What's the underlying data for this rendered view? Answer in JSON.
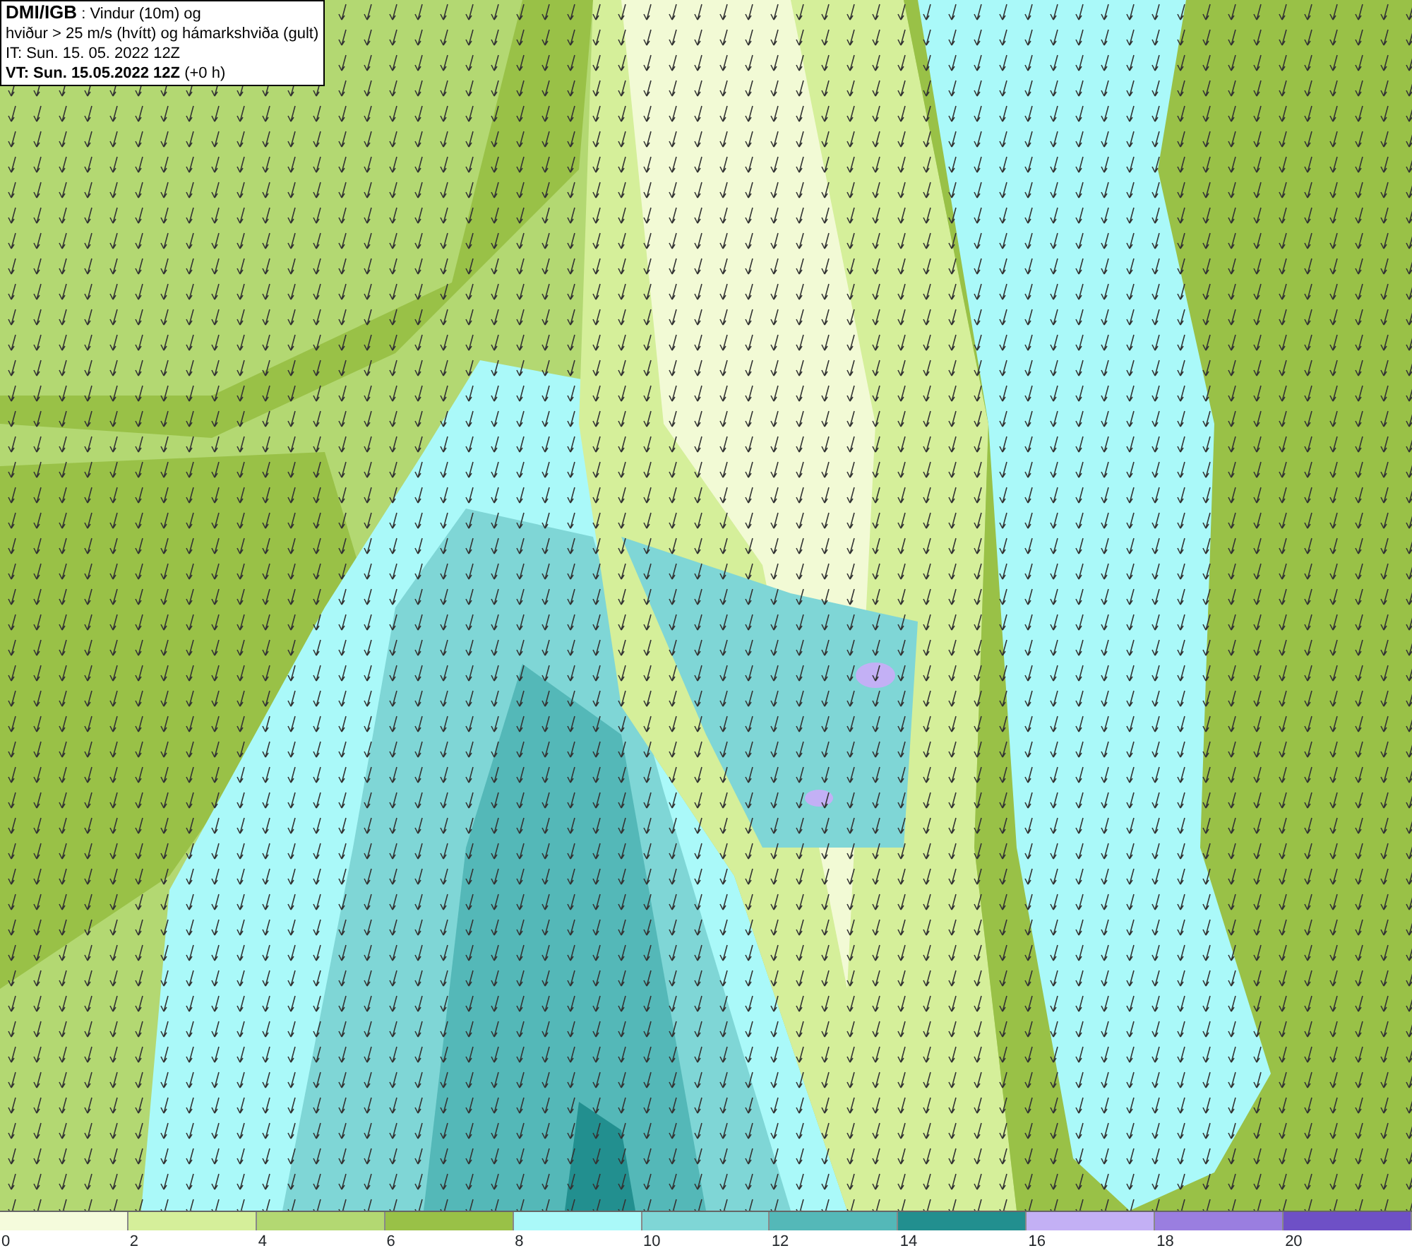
{
  "info_box": {
    "lines": [
      "**DMI/IGB** : Vindur (10m) og",
      "hviður > 25 m/s (hvítt) og hámarkshviða (gult)",
      "IT: Sun. 15. 05. 2022 12Z",
      "**VT: Sun. 15.05.2022 12Z** (+0 h)"
    ]
  },
  "legend": {
    "swatches": [
      {
        "color": "#f5fbdc"
      },
      {
        "color": "#d5ef9a"
      },
      {
        "color": "#b3d872"
      },
      {
        "color": "#99c147"
      },
      {
        "color": "#aaf9f9"
      },
      {
        "color": "#7fd6d6"
      },
      {
        "color": "#54b8b8"
      },
      {
        "color": "#228f8f"
      },
      {
        "color": "#c3b0f5"
      },
      {
        "color": "#9a7ee0"
      },
      {
        "color": "#6e50c6"
      }
    ],
    "ticks": [
      "0",
      "2",
      "4",
      "6",
      "8",
      "10",
      "12",
      "14",
      "16",
      "18",
      "20"
    ]
  }
}
